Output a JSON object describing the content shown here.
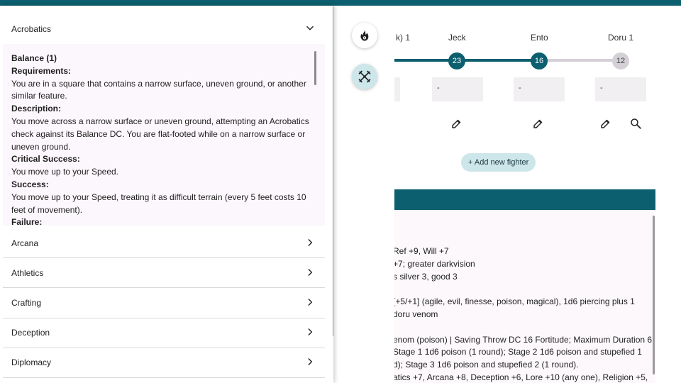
{
  "fighters": [
    {
      "name": "k) 1",
      "initiative": "",
      "value": ""
    },
    {
      "name": "Jeck",
      "initiative": "23",
      "value": "-"
    },
    {
      "name": "Ento",
      "initiative": "16",
      "value": "-"
    },
    {
      "name": "Doru 1",
      "initiative": "12",
      "value": "-"
    }
  ],
  "add_fighter_label": "+ Add new fighter",
  "stat_lines": [
    "Ref +9, Will +7",
    "+7; greater darkvision",
    "s silver 3, good 3",
    "[+5/+1] (agile, evil, finesse, poison, magical), 1d6 piercing plus 1",
    " doru venom",
    "enom (poison) | Saving Throw DC 16 Fortitude; Maximum Duration 6",
    " Stage 1 1d6 poison (1 round); Stage 2 1d6 poison and stupefied 1",
    "d); Stage 3 1d6 poison and stupefied 2 (1 round).",
    "atics +7, Arcana +8, Deception +6, Lore +10 (any one), Religion +5,"
  ],
  "skills": {
    "open": {
      "label": "Acrobatics",
      "content": [
        {
          "type": "h",
          "text": "Balance (1)"
        },
        {
          "type": "h",
          "text": "Requirements:"
        },
        {
          "type": "p",
          "text": "You are in a square that contains a narrow surface, uneven ground, or another similar feature."
        },
        {
          "type": "h",
          "text": "Description:"
        },
        {
          "type": "p",
          "text": "You move across a narrow surface or uneven ground, attempting an Acrobatics check against its Balance DC. You are flat-footed while on a narrow surface or uneven ground."
        },
        {
          "type": "h",
          "text": "Critical Success:"
        },
        {
          "type": "p",
          "text": "You move up to your Speed."
        },
        {
          "type": "h",
          "text": "Success:"
        },
        {
          "type": "p",
          "text": "You move up to your Speed, treating it as difficult terrain (every 5 feet costs 10 feet of movement)."
        },
        {
          "type": "h",
          "text": "Failure:"
        }
      ]
    },
    "collapsed": [
      "Arcana",
      "Athletics",
      "Crafting",
      "Deception",
      "Diplomacy"
    ]
  },
  "colors": {
    "accent": "#0c5f6e",
    "accent_light": "#cde6ea",
    "panel": "#fcf7fc"
  }
}
